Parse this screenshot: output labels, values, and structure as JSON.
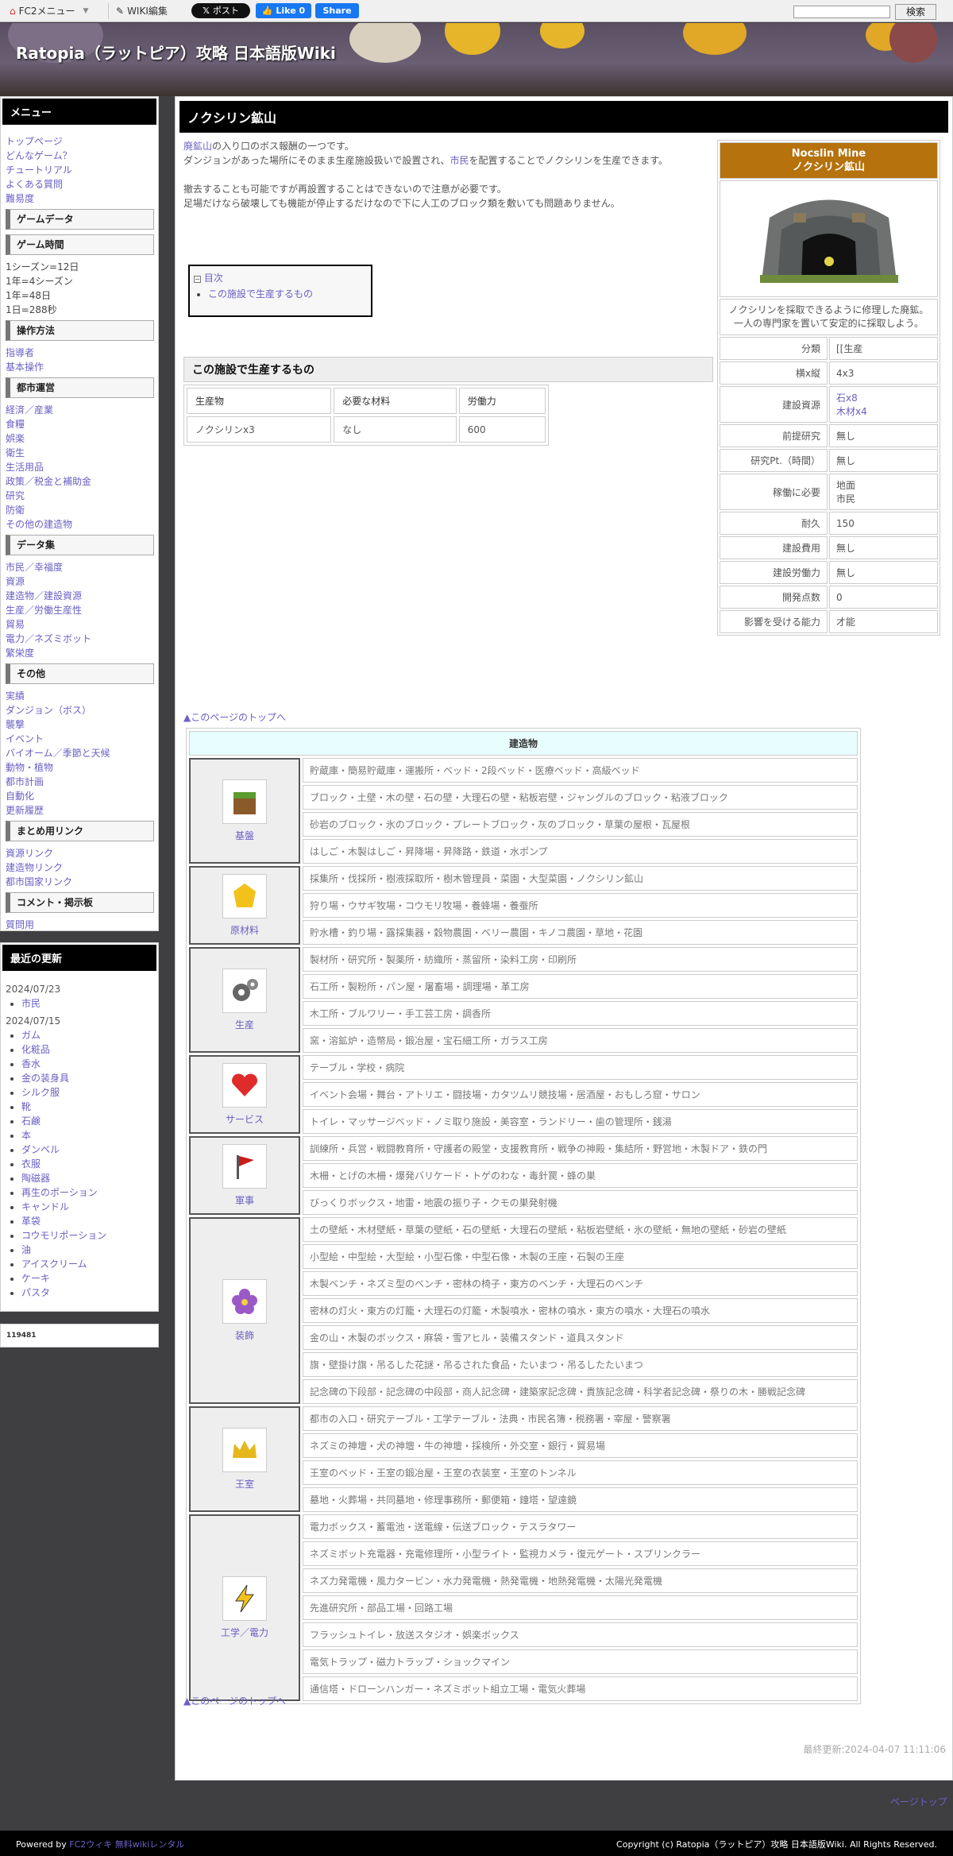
{
  "topbar": {
    "fc2_menu": "FC2メニュー",
    "wiki_edit": "WIKI編集",
    "x_post": "ポスト",
    "fb_like": "Like 0",
    "fb_share": "Share",
    "search_button": "検索"
  },
  "site": {
    "title": "Ratopia（ラットピア）攻略 日本語版Wiki"
  },
  "menu": {
    "title": "メニュー",
    "top_links": [
      "トップページ",
      "どんなゲーム？",
      "チュートリアル",
      "よくある質問",
      "難易度"
    ],
    "game_data": "ゲームデータ",
    "game_time": "ゲーム時間",
    "time_lines": [
      "1シーズン=12日",
      "1年=4シーズン",
      "1年=48日",
      "1日=288秒"
    ],
    "controls": "操作方法",
    "controls_links": [
      "指導者",
      "基本操作"
    ],
    "city": "都市運営",
    "city_links": [
      "経済／産業",
      "食糧",
      "娯楽",
      "衛生",
      "生活用品",
      "政策／税金と補助金",
      "研究",
      "防衛",
      "その他の建造物"
    ],
    "dataset": "データ集",
    "data_links": [
      "市民／幸福度",
      "資源",
      "建造物／建設資源",
      "生産／労働生産性",
      "貿易",
      "電力／ネズミボット",
      "繁栄度"
    ],
    "other": "その他",
    "other_links": [
      "実績",
      "ダンジョン（ボス）",
      "襲撃",
      "イベント",
      "バイオーム／季節と天候",
      "動物・植物",
      "都市計画",
      "自動化",
      "更新履歴"
    ],
    "summary": "まとめ用リンク",
    "summary_links": [
      "資源リンク",
      "建造物リンク",
      "都市国家リンク"
    ],
    "comment": "コメント・掲示板",
    "comment_links": [
      "質問用"
    ]
  },
  "recent": {
    "title": "最近の更新",
    "date1": "2024/07/23",
    "items1": [
      "市民"
    ],
    "date2": "2024/07/15",
    "items2": [
      "ガム",
      "化粧品",
      "香水",
      "金の装身具",
      "シルク服",
      "靴",
      "石鹸",
      "本",
      "ダンベル",
      "衣服",
      "陶磁器",
      "再生のポーション",
      "キャンドル",
      "革袋",
      "コウモリポーション",
      "油",
      "アイスクリーム",
      "ケーキ",
      "パスタ"
    ]
  },
  "counter": "119481",
  "page": {
    "title": "ノクシリン鉱山",
    "intro_link1": "廃鉱山",
    "intro_text1": "の入り口のボス報酬の一つです。",
    "intro_text2": "ダンジョンがあった場所にそのまま生産施設扱いで設置され、",
    "intro_link2": "市民",
    "intro_text3": "を配置することでノクシリンを生産できます。",
    "intro_text4": "撤去することも可能ですが再設置することはできないので注意が必要です。",
    "intro_text5": "足場だけなら破壊しても機能が停止するだけなので下に人工のブロック類を敷いても問題ありません。",
    "toc_title": "目次",
    "toc_item": "この施設で生産するもの",
    "section": "この施設で生産するもの",
    "prod_headers": [
      "生産物",
      "必要な材料",
      "労働力"
    ],
    "prod_row": [
      "ノクシリンx3",
      "なし",
      "600"
    ],
    "to_top": "▲このページのトップへ",
    "updated": "最終更新:2024-04-07 11:11:06"
  },
  "infobox": {
    "name_en": "Nocslin Mine",
    "name_ja": "ノクシリン鉱山",
    "desc": "ノクシリンを採取できるように修理した廃鉱。一人の専門家を置いて安定的に採取しよう。",
    "rows": [
      [
        "分類",
        "[[生産"
      ],
      [
        "横x縦",
        "4x3"
      ],
      [
        "建設資源",
        "石x8|木材x4"
      ],
      [
        "前提研究",
        "無し"
      ],
      [
        "研究Pt.（時間）",
        "無し"
      ],
      [
        "稼働に必要",
        "地面|市民"
      ],
      [
        "耐久",
        "150"
      ],
      [
        "建設費用",
        "無し"
      ],
      [
        "建設労働力",
        "無し"
      ],
      [
        "開発点数",
        "0"
      ],
      [
        "影響を受ける能力",
        "才能"
      ]
    ]
  },
  "buildings": {
    "caption": "建造物",
    "categories": [
      {
        "name": "基盤",
        "icon": "soil-block-icon",
        "rows": [
          "貯蔵庫・簡易貯蔵庫・運搬所・ベッド・2段ベッド・医療ベッド・高級ベッド",
          "ブロック・土壁・木の壁・石の壁・大理石の壁・粘板岩壁・ジャングルのブロック・粘液ブロック",
          "砂岩のブロック・氷のブロック・プレートブロック・灰のブロック・草葉の屋根・瓦屋根",
          "はしご・木製はしご・昇降場・昇降路・鉄道・水ポンプ"
        ]
      },
      {
        "name": "原材料",
        "icon": "gold-ore-icon",
        "rows": [
          "採集所・伐採所・樹液採取所・樹木管理員・菜園・大型菜園・ノクシリン鉱山",
          "狩り場・ウサギ牧場・コウモリ牧場・養蜂場・養蚕所",
          "貯水槽・釣り場・露採集器・穀物農園・ベリー農園・キノコ農園・草地・花園"
        ]
      },
      {
        "name": "生産",
        "icon": "gears-icon",
        "rows": [
          "製材所・研究所・製薬所・紡織所・蒸留所・染料工房・印刷所",
          "石工所・製粉所・パン屋・屠畜場・調理場・革工房",
          "木工所・ブルワリー・手工芸工房・調香所",
          "窯・溶鉱炉・造幣局・鍛冶屋・宝石細工所・ガラス工房"
        ]
      },
      {
        "name": "サービス",
        "icon": "heart-icon",
        "rows": [
          "テーブル・学校・病院",
          "イベント会場・舞台・アトリエ・闘技場・カタツムリ競技場・居酒屋・おもしろ窟・サロン",
          "トイレ・マッサージベッド・ノミ取り施設・美容室・ランドリー・歯の管理所・銭湯"
        ]
      },
      {
        "name": "軍事",
        "icon": "flag-icon",
        "rows": [
          "訓練所・兵営・戦闘教育所・守護者の殿堂・支援教育所・戦争の神殿・集結所・野営地・木製ドア・鉄の門",
          "木柵・とげの木柵・爆発バリケード・トゲのわな・毒針罠・蜂の巣",
          "びっくりボックス・地雷・地震の振り子・クモの巣発射機"
        ]
      },
      {
        "name": "装飾",
        "icon": "flower-icon",
        "rows": [
          "土の壁紙・木材壁紙・草葉の壁紙・石の壁紙・大理石の壁紙・粘板岩壁紙・氷の壁紙・無地の壁紙・砂岩の壁紙",
          "小型絵・中型絵・大型絵・小型石像・中型石像・木製の王座・石製の王座",
          "木製ベンチ・ネズミ型のベンチ・密林の椅子・東方のベンチ・大理石のベンチ",
          "密林の灯火・東方の灯籠・大理石の灯籠・木製噴水・密林の噴水・東方の噴水・大理石の噴水",
          "金の山・木製のボックス・麻袋・雪アヒル・装備スタンド・道具スタンド",
          "旗・壁掛け旗・吊るした花謎・吊るされた食品・たいまつ・吊るしたたいまつ",
          "記念碑の下段部・記念碑の中段部・商人記念碑・建築家記念碑・貴族記念碑・科学者記念碑・祭りの木・勝戦記念碑"
        ]
      },
      {
        "name": "王室",
        "icon": "crown-icon",
        "rows": [
          "都市の入口・研究テーブル・工学テーブル・法典・市民名簿・税務署・宰屋・警察署",
          "ネズミの神壇・犬の神壇・牛の神壇・採検所・外交室・銀行・貿易場",
          "王室のベッド・王室の鍛冶屋・王室の衣装室・王室のトンネル",
          "墓地・火葬場・共同墓地・修理事務所・郵便箱・鐘塔・望遠鏡"
        ]
      },
      {
        "name": "工学／電力",
        "icon": "lightning-icon",
        "rows": [
          "電力ボックス・蓄電池・送電線・伝送ブロック・テスラタワー",
          "ネズミボット充電器・充電修理所・小型ライト・監視カメラ・復元ゲート・スプリンクラー",
          "ネズ力発電機・風力タービン・水力発電機・熱発電機・地熱発電機・太陽光発電機",
          "先進研究所・部品工場・回路工場",
          "フラッシュトイレ・放送スタジオ・娯楽ボックス",
          "電気トラップ・磁力トラップ・ショックマイン",
          "通信塔・ドローンハンガー・ネズミボット組立工場・電気火葬場"
        ]
      }
    ]
  },
  "pagetop": "ページトップ",
  "footer": {
    "powered": "Powered by",
    "fc2": "FC2ウィキ 無料wikiレンタル",
    "copyright": "Copyright (c) Ratopia（ラットピア）攻略 日本語版Wiki. All Rights Reserved."
  }
}
